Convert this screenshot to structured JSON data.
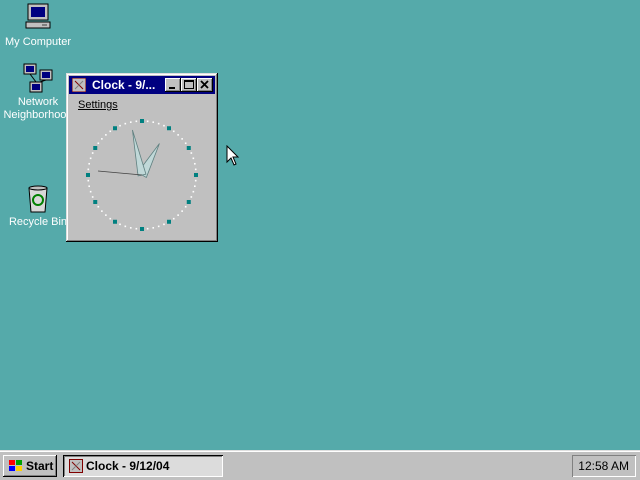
{
  "desktop": {
    "icons": [
      {
        "label": "My Computer",
        "icon": "my-computer-icon"
      },
      {
        "label": "Network Neighborhood",
        "label_line1": "Network",
        "label_line2": "Neighborhood",
        "icon": "network-icon"
      },
      {
        "label": "Recycle Bin",
        "icon": "recycle-bin-icon"
      }
    ]
  },
  "window": {
    "title": "Clock - 9/...",
    "menu": {
      "settings": "Settings"
    },
    "clock": {
      "time": "12:58",
      "hour": 12,
      "minute": 58
    }
  },
  "taskbar": {
    "start_label": "Start",
    "task_label": "Clock - 9/12/04",
    "time": "12:58 AM"
  },
  "colors": {
    "desktop": "#55aaaa",
    "titlebar": "#000080",
    "face": "#c0c0c0",
    "hands": "#c0d8d8",
    "markers": "#008080"
  }
}
